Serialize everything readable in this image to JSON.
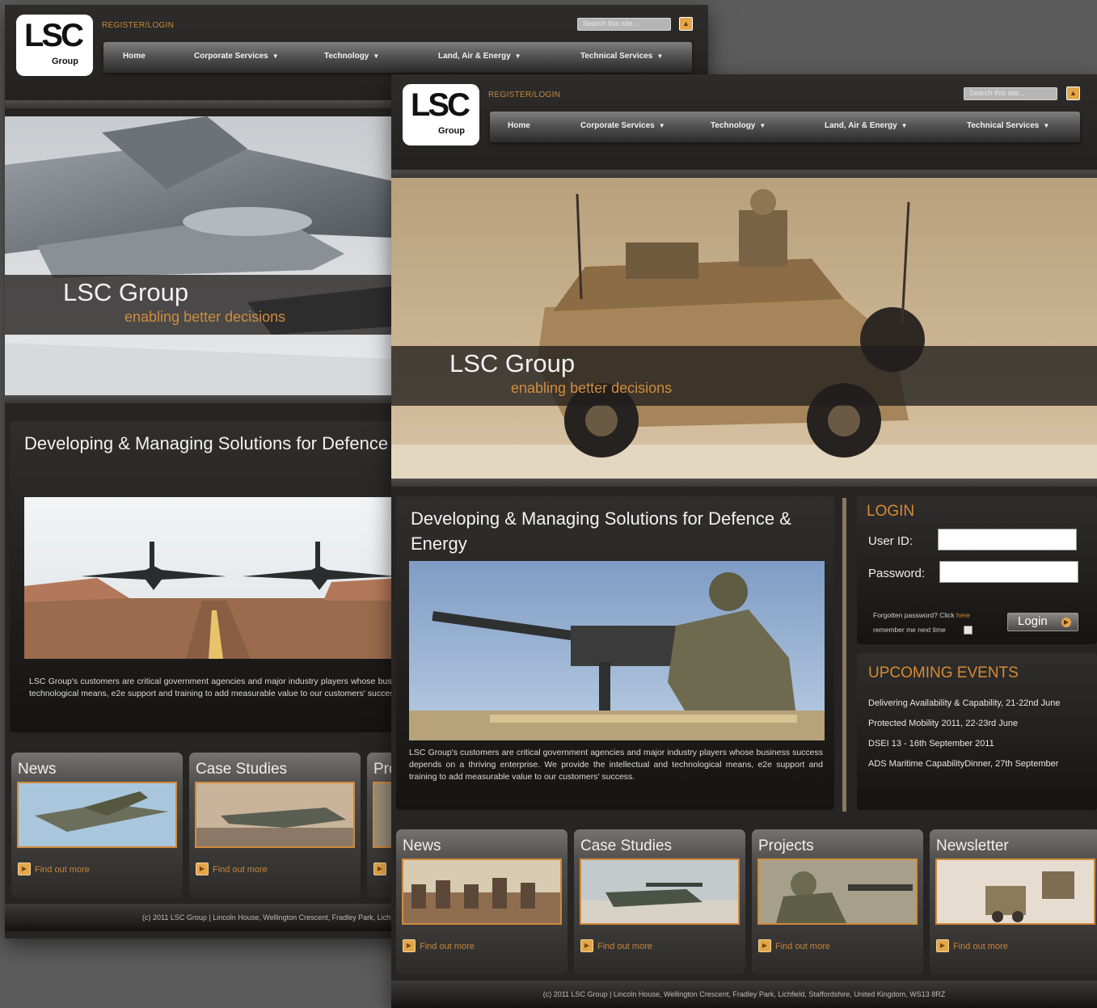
{
  "site": {
    "logo_text": "LSC",
    "logo_sub": "Group",
    "register_login": "REGISTER/LOGIN",
    "search_placeholder": "Search this site...",
    "nav": [
      "Home",
      "Corporate Services",
      "Technology",
      "Land, Air & Energy",
      "Technical Services"
    ],
    "nav_arrow": "▼",
    "hero_title": "LSC Group",
    "hero_tagline": "enabling better decisions",
    "intro_title": "Developing & Managing Solutions for Defence & Energy",
    "intro_text": "LSC Group's customers are critical government agencies and major industry players whose business success depends on a thriving enterprise. We provide the intellectual and technological means, e2e support and training to add measurable value to our customers' success.",
    "find_out_more": "Find out more",
    "footer": "(c) 2011 LSC Group | Lincoln House, Wellington Crescent, Fradley Park, Lichfield, Staffordshire, United Kingdom, WS13 8RZ"
  },
  "back_page": {
    "cards": [
      "News",
      "Case Studies",
      "Projects"
    ]
  },
  "front_page": {
    "cards": [
      "News",
      "Case Studies",
      "Projects",
      "Newsletter"
    ],
    "login": {
      "title": "LOGIN",
      "user_label": "User ID:",
      "password_label": "Password:",
      "forgotten": "Forgotten password? Click",
      "here": "here",
      "remember": "remember me next time",
      "button": "Login"
    },
    "events": {
      "title": "UPCOMING EVENTS",
      "items": [
        "Delivering Availability & Capability, 21-22nd June",
        "Protected Mobility 2011, 22-23rd June",
        "DSEI 13 - 16th September 2011",
        "ADS Maritime CapabilityDinner, 27th September"
      ]
    }
  }
}
